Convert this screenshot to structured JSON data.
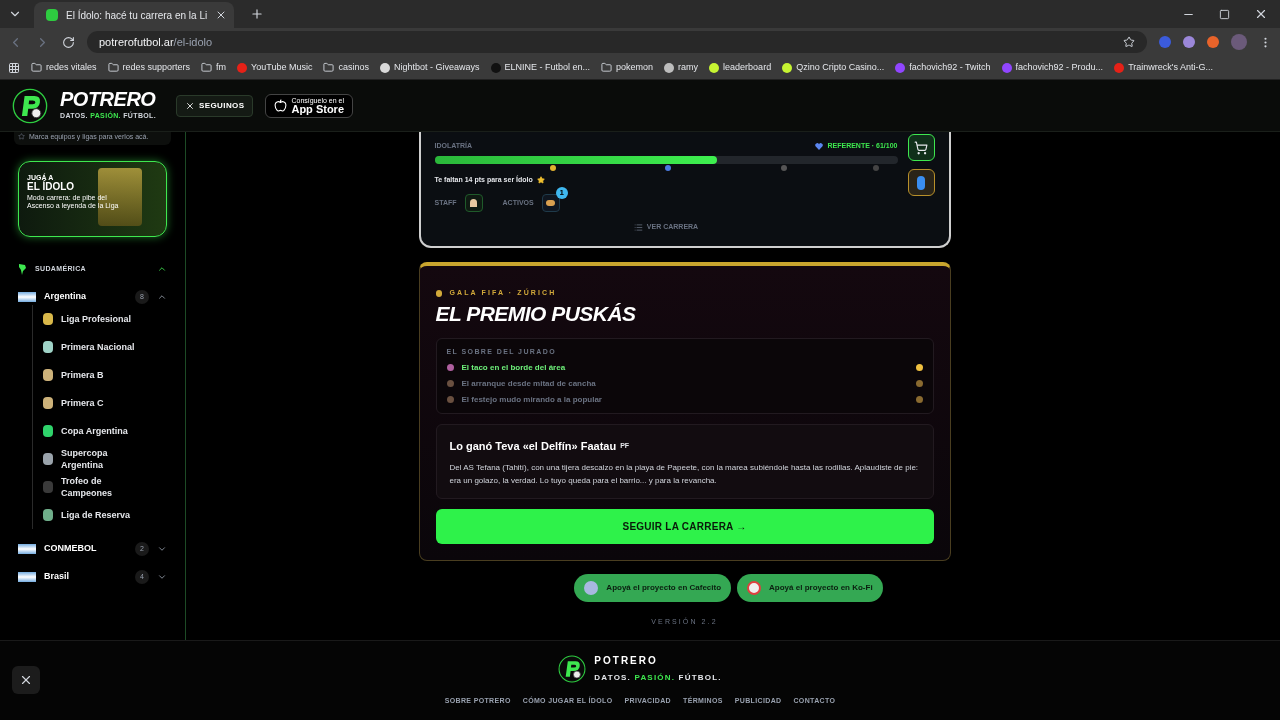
{
  "browser": {
    "tab_title": "El Ídolo: hacé tu carrera en la Li",
    "url_host": "potrerofutbol.ar",
    "url_path": "/el-idolo",
    "bookmarks": [
      {
        "label": "redes vitales",
        "kind": "folder"
      },
      {
        "label": "redes supporters",
        "kind": "folder"
      },
      {
        "label": "fm",
        "kind": "folder"
      },
      {
        "label": "YouTube Music",
        "kind": "site",
        "color": "#e62117"
      },
      {
        "label": "casinos",
        "kind": "folder"
      },
      {
        "label": "Nightbot - Giveaways",
        "kind": "site",
        "color": "#d9d9d9"
      },
      {
        "label": "ELNINE - Futbol en...",
        "kind": "site",
        "color": "#111111"
      },
      {
        "label": "pokemon",
        "kind": "folder"
      },
      {
        "label": "ramy",
        "kind": "site",
        "color": "#bdbdbd"
      },
      {
        "label": "leaderboard",
        "kind": "site",
        "color": "#c6f432"
      },
      {
        "label": "Qzino Cripto Casino...",
        "kind": "site",
        "color": "#c6f432"
      },
      {
        "label": "fachovich92 - Twitch",
        "kind": "site",
        "color": "#9146ff"
      },
      {
        "label": "fachovich92 - Produ...",
        "kind": "site",
        "color": "#9146ff"
      },
      {
        "label": "Trainwreck's Anti-G...",
        "kind": "site",
        "color": "#e62117"
      }
    ]
  },
  "header": {
    "brand": "POTRERO",
    "tagline": [
      "DATOS.",
      "PASIÓN.",
      "FÚTBOL."
    ],
    "follow_button": "SEGUINOS",
    "app_store": {
      "small": "Consíguelo en el",
      "big": "App Store"
    }
  },
  "sidebar": {
    "favorites_hint": "Marca equipos y ligas para verlos acá.",
    "promo": {
      "kicker": "JUGÁ A",
      "title": "EL ÍDOLO",
      "text": "Modo carrera: de pibe del Ascenso a leyenda de la Liga"
    },
    "region": {
      "label": "SUDAMÉRICA",
      "expanded": true
    },
    "countries": [
      {
        "name": "Argentina",
        "count": "8",
        "expanded": true,
        "children": [
          {
            "label": "Liga Profesional",
            "color": "#d9b84a"
          },
          {
            "label": "Primera Nacional",
            "color": "#9fd3c7"
          },
          {
            "label": "Primera B",
            "color": "#cdb27a"
          },
          {
            "label": "Primera C",
            "color": "#cdb27a"
          },
          {
            "label": "Copa Argentina",
            "color": "#2fd36b"
          },
          {
            "label": "Supercopa Argentina",
            "color": "#9aa3ab"
          },
          {
            "label": "Trofeo de Campeones",
            "color": "#3a3a3a"
          },
          {
            "label": "Liga de Reserva",
            "color": "#6fae8a"
          }
        ]
      },
      {
        "name": "CONMEBOL",
        "count": "2",
        "expanded": false
      },
      {
        "name": "Brasil",
        "count": "4",
        "expanded": false
      }
    ]
  },
  "career": {
    "label": "IDOLATRÍA",
    "status": "REFERENTE · 61/100",
    "level": 0.61,
    "hint": "Te faltan 14 pts para ser Ídolo",
    "staff_label": "STAFF",
    "assets_label": "ACTIVOS",
    "assets_badge": "1",
    "link": "VER CARRERA"
  },
  "award": {
    "kicker": "GALA FIFA · ZÚRICH",
    "title": "EL PREMIO PUSKÁS",
    "jury_label": "EL SOBRE DEL JURADO",
    "options": [
      {
        "label": "El taco en el borde del área",
        "selected": true
      },
      {
        "label": "El arranque desde mitad de cancha",
        "selected": false
      },
      {
        "label": "El festejo mudo mirando a la popular",
        "selected": false
      }
    ],
    "result_title": "Lo ganó Teva «el Delfín» Faatau",
    "result_tag": "PF",
    "result_text": "Del AS Tefana (Tahití), con una tijera descalzo en la playa de Papeete, con la marea subiéndole hasta las rodillas. Aplaudiste de pie: era un golazo, la verdad. Lo tuyo queda para el barrio... y para la revancha.",
    "button": "SEGUIR LA CARRERA →"
  },
  "support": [
    "Apoyá el proyecto en Cafecito",
    "Apoyá el proyecto en Ko-Fi"
  ],
  "version": "VERSIÓN 2.2",
  "footer": {
    "brand": "POTRERO",
    "tagline": [
      "DATOS.",
      "PASIÓN.",
      "FÚTBOL."
    ],
    "links": [
      "SOBRE POTRERO",
      "CÓMO JUGAR EL ÍDOLO",
      "PRIVACIDAD",
      "TÉRMINOS",
      "PUBLICIDAD",
      "CONTACTO"
    ]
  }
}
